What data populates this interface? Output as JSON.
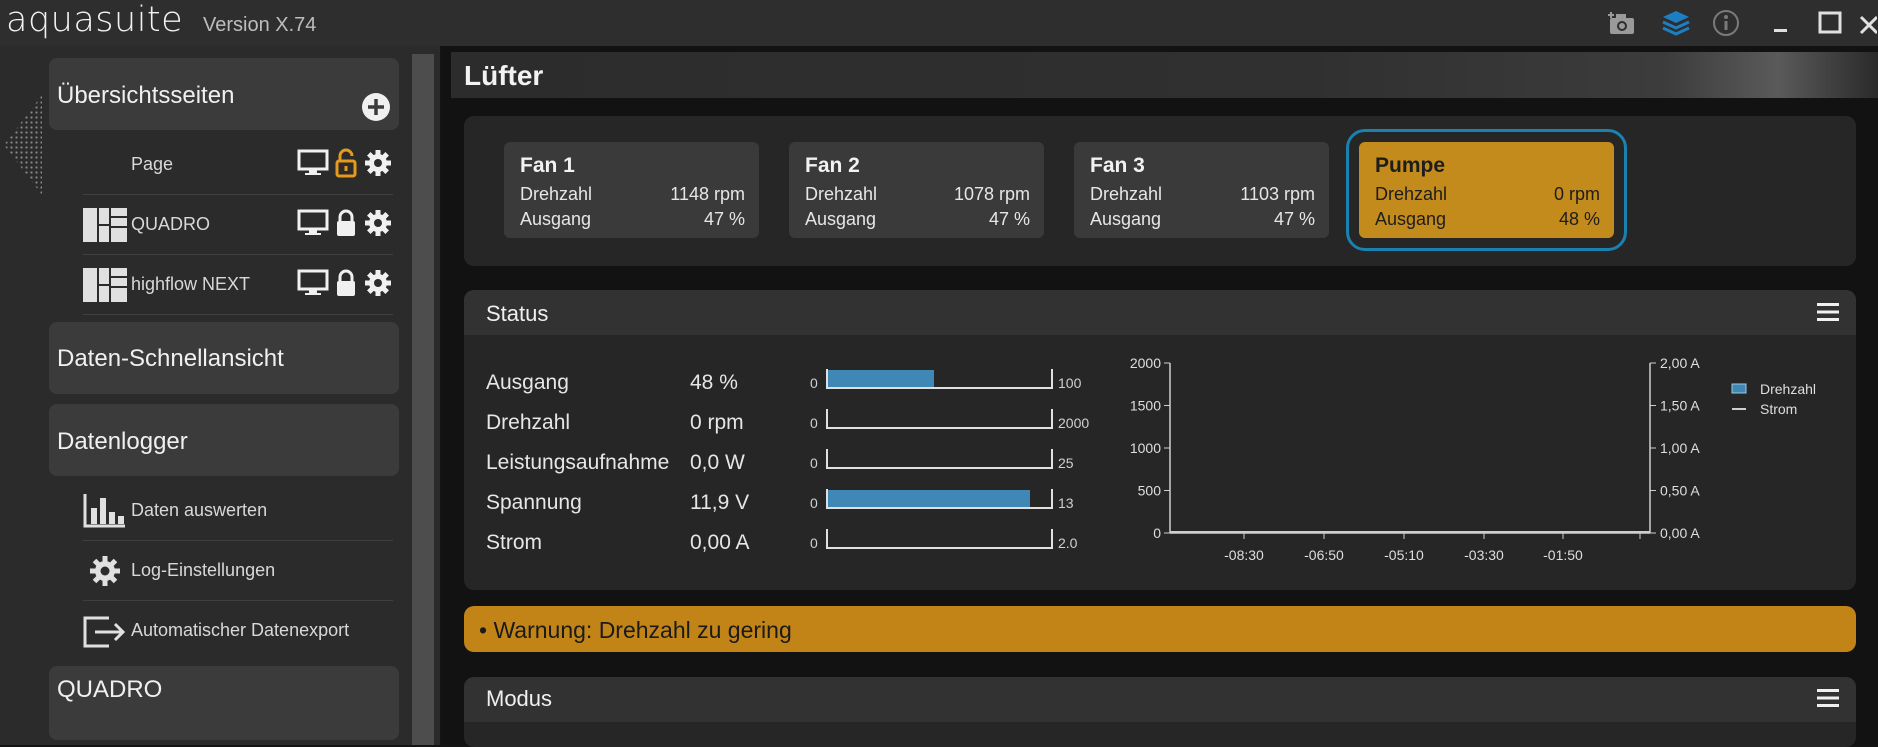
{
  "app": {
    "name": "aquasuite",
    "version": "Version X.74"
  },
  "window_controls": {
    "icons": [
      "camera-add-icon",
      "layers-icon",
      "info-icon",
      "minimize-icon",
      "maximize-icon",
      "close-icon"
    ]
  },
  "sidebar": {
    "sections": [
      {
        "title": "Übersichtsseiten",
        "items": [
          {
            "label": "Page",
            "lock": "unlocked"
          },
          {
            "label": "QUADRO",
            "lock": "locked"
          },
          {
            "label": "highflow NEXT",
            "lock": "locked"
          }
        ]
      },
      {
        "title": "Daten-Schnellansicht"
      },
      {
        "title": "Datenlogger",
        "items": [
          {
            "label": "Daten auswerten",
            "icon": "bar-chart-icon"
          },
          {
            "label": "Log-Einstellungen",
            "icon": "gear-icon"
          },
          {
            "label": "Automatischer Datenexport",
            "icon": "export-icon"
          }
        ]
      },
      {
        "title": "QUADRO"
      }
    ]
  },
  "page": {
    "title": "Lüfter"
  },
  "fans": [
    {
      "name": "Fan 1",
      "speed_label": "Drehzahl",
      "speed": "1148 rpm",
      "output_label": "Ausgang",
      "output": "47 %"
    },
    {
      "name": "Fan 2",
      "speed_label": "Drehzahl",
      "speed": "1078 rpm",
      "output_label": "Ausgang",
      "output": "47 %"
    },
    {
      "name": "Fan 3",
      "speed_label": "Drehzahl",
      "speed": "1103 rpm",
      "output_label": "Ausgang",
      "output": "47 %"
    },
    {
      "name": "Pumpe",
      "speed_label": "Drehzahl",
      "speed": "0 rpm",
      "output_label": "Ausgang",
      "output": "48 %"
    }
  ],
  "status": {
    "title": "Status",
    "rows": [
      {
        "label": "Ausgang",
        "value": "48 %",
        "min": "0",
        "max": "100",
        "fill": 0.48
      },
      {
        "label": "Drehzahl",
        "value": "0 rpm",
        "min": "0",
        "max": "2000",
        "fill": 0
      },
      {
        "label": "Leistungsaufnahme",
        "value": "0,0 W",
        "min": "0",
        "max": "25",
        "fill": 0
      },
      {
        "label": "Spannung",
        "value": "11,9 V",
        "min": "0",
        "max": "13",
        "fill": 0.915
      },
      {
        "label": "Strom",
        "value": "0,00 A",
        "min": "0",
        "max": "2.0",
        "fill": 0
      }
    ]
  },
  "chart_data": {
    "type": "line",
    "x_ticks": [
      "-08:30",
      "-06:50",
      "-05:10",
      "-03:30",
      "-01:50"
    ],
    "y_left_ticks": [
      "0",
      "500",
      "1000",
      "1500",
      "2000"
    ],
    "y_right_ticks": [
      "0,00 A",
      "0,50 A",
      "1,00 A",
      "1,50 A",
      "2,00 A"
    ],
    "ylim_left": [
      0,
      2000
    ],
    "ylim_right": [
      0,
      2
    ],
    "legend_position": "right",
    "series": [
      {
        "name": "Drehzahl",
        "axis": "left",
        "color": "#3f88b5",
        "values": [
          0,
          0
        ]
      },
      {
        "name": "Strom",
        "axis": "right",
        "color": "#cfcfcf",
        "values": [
          0,
          0
        ]
      }
    ]
  },
  "warning": {
    "text": "• Warnung: Drehzahl zu gering"
  },
  "modus": {
    "title": "Modus"
  },
  "colors": {
    "accent_orange": "#c38a1c",
    "accent_blue": "#1a82b0",
    "bar_blue": "#3f88b5"
  }
}
